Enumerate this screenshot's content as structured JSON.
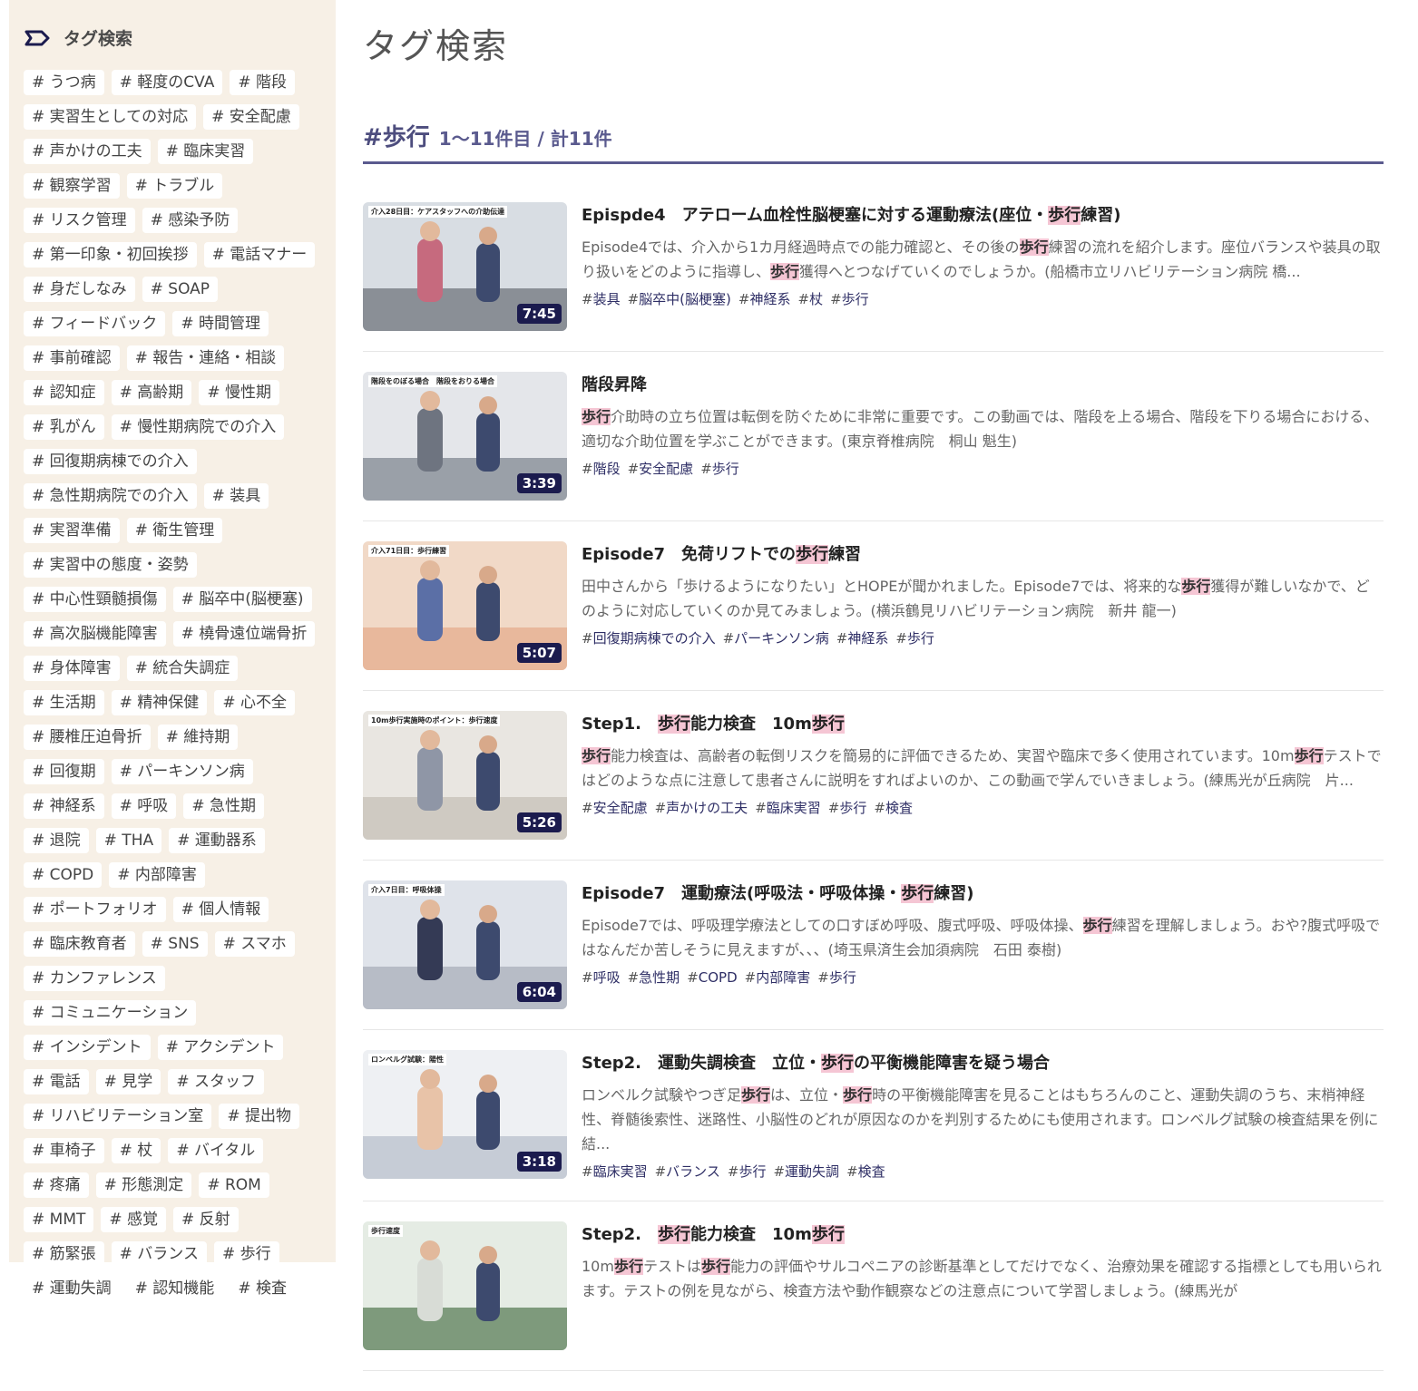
{
  "sidebar": {
    "title": "タグ検索",
    "tags": [
      "# うつ病",
      "# 軽度のCVA",
      "# 階段",
      "# 実習生としての対応",
      "# 安全配慮",
      "# 声かけの工夫",
      "# 臨床実習",
      "# 観察学習",
      "# トラブル",
      "# リスク管理",
      "# 感染予防",
      "# 第一印象・初回挨拶",
      "# 電話マナー",
      "# 身だしなみ",
      "# SOAP",
      "# フィードバック",
      "# 時間管理",
      "# 事前確認",
      "# 報告・連絡・相談",
      "# 認知症",
      "# 高齢期",
      "# 慢性期",
      "# 乳がん",
      "# 慢性期病院での介入",
      "# 回復期病棟での介入",
      "# 急性期病院での介入",
      "# 装具",
      "# 実習準備",
      "# 衛生管理",
      "# 実習中の態度・姿勢",
      "# 中心性頸髄損傷",
      "# 脳卒中(脳梗塞)",
      "# 高次脳機能障害",
      "# 橈骨遠位端骨折",
      "# 身体障害",
      "# 統合失調症",
      "# 生活期",
      "# 精神保健",
      "# 心不全",
      "# 腰椎圧迫骨折",
      "# 維持期",
      "# 回復期",
      "# パーキンソン病",
      "# 神経系",
      "# 呼吸",
      "# 急性期",
      "# 退院",
      "# THA",
      "# 運動器系",
      "# COPD",
      "# 内部障害",
      "# ポートフォリオ",
      "# 個人情報",
      "# 臨床教育者",
      "# SNS",
      "# スマホ",
      "# カンファレンス",
      "# コミュニケーション",
      "# インシデント",
      "# アクシデント",
      "# 電話",
      "# 見学",
      "# スタッフ",
      "# リハビリテーション室",
      "# 提出物",
      "# 車椅子",
      "# 杖",
      "# バイタル",
      "# 疼痛",
      "# 形態測定",
      "# ROM",
      "# MMT",
      "# 感覚",
      "# 反射",
      "# 筋緊張",
      "# バランス",
      "# 歩行",
      "# 運動失調",
      "# 認知機能",
      "# 検査"
    ]
  },
  "main": {
    "page_title": "タグ検索",
    "result_tag": "#歩行",
    "result_count": "1〜11件目 / 計11件"
  },
  "videos": [
    {
      "title_parts": [
        "Epispde4　アテローム血栓性脳梗塞に対する運動療法(座位・",
        "歩行",
        "練習)"
      ],
      "desc_parts": [
        "Episode4では、介入から1カ月経過時点での能力確認と、その後の",
        "歩行",
        "練習の流れを紹介します。座位バランスや装具の取り扱いをどのように指導し、",
        "歩行",
        "獲得へとつなげていくのでしょうか。(船橋市立リハビリテーション病院 橋..."
      ],
      "tags": [
        "装具",
        "脳卒中(脳梗塞)",
        "神経系",
        "杖",
        "歩行"
      ],
      "duration": "7:45",
      "thumb_label": "介入28日目：ケアスタッフへの介助伝達"
    },
    {
      "title_parts": [
        "階段昇降"
      ],
      "desc_parts": [
        "",
        "歩行",
        "介助時の立ち位置は転倒を防ぐために非常に重要です。この動画では、階段を上る場合、階段を下りる場合における、適切な介助位置を学ぶことができます。(東京脊椎病院　桐山 魁生)"
      ],
      "tags": [
        "階段",
        "安全配慮",
        "歩行"
      ],
      "duration": "3:39",
      "thumb_label": "階段をのぼる場合　階段をおりる場合"
    },
    {
      "title_parts": [
        "Episode7　免荷リフトでの",
        "歩行",
        "練習"
      ],
      "desc_parts": [
        "田中さんから「歩けるようになりたい」とHOPEが聞かれました。Episode7では、将来的な",
        "歩行",
        "獲得が難しいなかで、どのように対応していくのか見てみましょう。(横浜鶴見リハビリテーション病院　新井 龍一)"
      ],
      "tags": [
        "回復期病棟での介入",
        "パーキンソン病",
        "神経系",
        "歩行"
      ],
      "duration": "5:07",
      "thumb_label": "介入71日目：歩行練習"
    },
    {
      "title_parts": [
        "Step1.　",
        "歩行",
        "能力検査　10m",
        "歩行"
      ],
      "desc_parts": [
        "",
        "歩行",
        "能力検査は、高齢者の転倒リスクを簡易的に評価できるため、実習や臨床で多く使用されています。10m",
        "歩行",
        "テストではどのような点に注意して患者さんに説明をすればよいのか、この動画で学んでいきましょう。(練馬光が丘病院　片..."
      ],
      "tags": [
        "安全配慮",
        "声かけの工夫",
        "臨床実習",
        "歩行",
        "検査"
      ],
      "duration": "5:26",
      "thumb_label": "10m歩行実施時のポイント：歩行速度"
    },
    {
      "title_parts": [
        "Episode7　運動療法(呼吸法・呼吸体操・",
        "歩行",
        "練習)"
      ],
      "desc_parts": [
        "Episode7では、呼吸理学療法としての口すぼめ呼吸、腹式呼吸、呼吸体操、",
        "歩行",
        "練習を理解しましょう。おや?腹式呼吸ではなんだか苦しそうに見えますが、、、(埼玉県済生会加須病院　石田 泰樹)"
      ],
      "tags": [
        "呼吸",
        "急性期",
        "COPD",
        "内部障害",
        "歩行"
      ],
      "duration": "6:04",
      "thumb_label": "介入7日目：呼吸体操"
    },
    {
      "title_parts": [
        "Step2.　運動失調検査　立位・",
        "歩行",
        "の平衡機能障害を疑う場合"
      ],
      "desc_parts": [
        "ロンベルク試験やつぎ足",
        "歩行",
        "は、立位・",
        "歩行",
        "時の平衡機能障害を見ることはもちろんのこと、運動失調のうち、末梢神経性、脊髄後索性、迷路性、小脳性のどれが原因なのかを判別するためにも使用されます。ロンベルグ試験の検査結果を例に結..."
      ],
      "tags": [
        "臨床実習",
        "バランス",
        "歩行",
        "運動失調",
        "検査"
      ],
      "duration": "3:18",
      "thumb_label": "ロンベルグ試験：陽性"
    },
    {
      "title_parts": [
        "Step2.　",
        "歩行",
        "能力検査　10m",
        "歩行"
      ],
      "desc_parts": [
        "10m",
        "歩行",
        "テストは",
        "歩行",
        "能力の評価やサルコペニアの診断基準としてだけでなく、治療効果を確認する指標としても用いられます。テストの例を見ながら、検査方法や動作観察などの注意点について学習しましょう。(練馬光が"
      ],
      "tags": [],
      "duration": "",
      "thumb_label": "歩行速度"
    }
  ],
  "colors": {
    "sidebar_bg": "#f7f0e6",
    "accent": "#4d4d7e",
    "highlight": "#f5c6d4",
    "duration_bg": "#1b1b4e"
  }
}
